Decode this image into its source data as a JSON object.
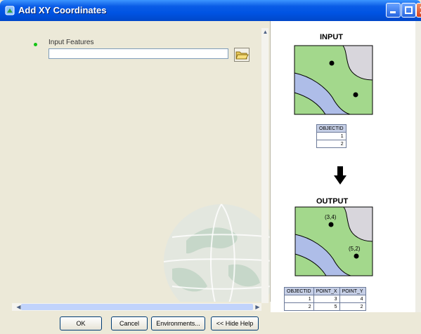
{
  "window": {
    "title": "Add XY Coordinates"
  },
  "form": {
    "input_features_label": "Input Features",
    "input_features_value": ""
  },
  "help_panel": {
    "input_title": "INPUT",
    "output_title": "OUTPUT",
    "input_table": {
      "headers": [
        "OBJECTID"
      ],
      "rows": [
        [
          "1"
        ],
        [
          "2"
        ]
      ]
    },
    "output_table": {
      "headers": [
        "OBJECTID",
        "POINT_X",
        "POINT_Y"
      ],
      "rows": [
        [
          "1",
          "3",
          "4"
        ],
        [
          "2",
          "5",
          "2"
        ]
      ]
    },
    "point_labels": [
      "(3,4)",
      "(5,2)"
    ]
  },
  "buttons": {
    "ok": "OK",
    "cancel": "Cancel",
    "environments": "Environments...",
    "hide_help": "<< Hide Help"
  },
  "colors": {
    "titlebar": "#0054e3",
    "land": "#a3d88c",
    "water": "#aebde8",
    "zone": "#d8d6dc",
    "table_header": "#c6cfe6"
  }
}
